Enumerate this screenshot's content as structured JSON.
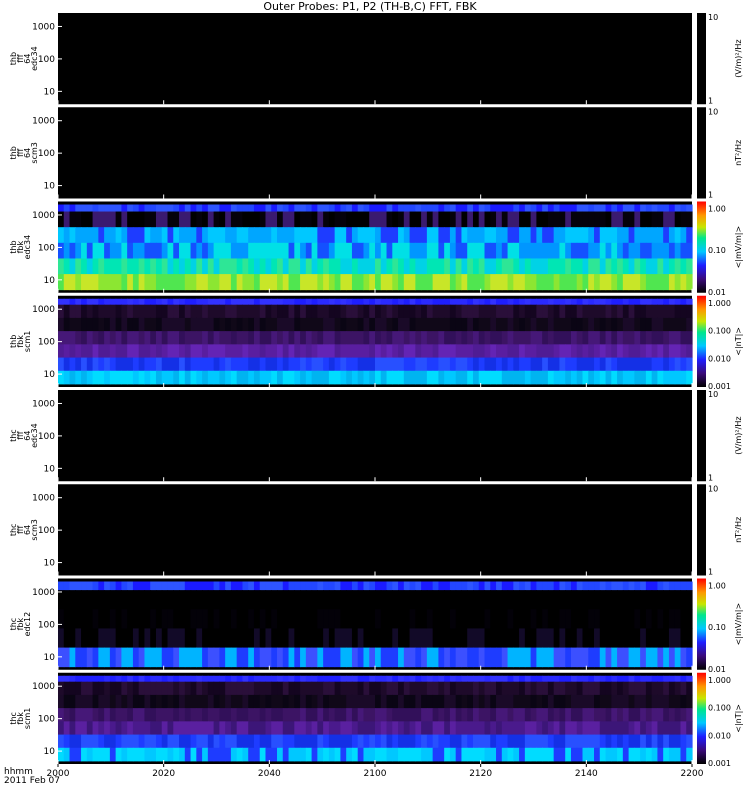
{
  "title": "Outer Probes: P1, P2 (TH-B,C) FFT, FBK",
  "footer": {
    "unit": "hhmm",
    "date": "2011 Feb 07"
  },
  "colors": {
    "background": "#ffffff",
    "panel_empty": "#000000"
  },
  "chart_data": {
    "type": "heatmap",
    "x_ticks": [
      "2000",
      "2020",
      "2040",
      "2100",
      "2120",
      "2140",
      "2200"
    ],
    "x_range": [
      "2000",
      "2200"
    ],
    "panels": [
      {
        "id": "thb_fff64_edc34",
        "label_lines": [
          "thb",
          "fff",
          "64",
          "edc34"
        ],
        "y_ticks": [
          "10",
          "100",
          "1000"
        ],
        "y_scale": "log",
        "colorbar": {
          "type": "gray",
          "ticks": [
            "10",
            "1"
          ],
          "unit": "(V/m)²/Hz"
        },
        "content": "empty"
      },
      {
        "id": "thb_fff64_scm3",
        "label_lines": [
          "thb",
          "fff",
          "64",
          "scm3"
        ],
        "y_ticks": [
          "10",
          "100",
          "1000"
        ],
        "y_scale": "log",
        "colorbar": {
          "type": "gray",
          "ticks": [
            "10",
            "1"
          ],
          "unit": "nT²/Hz"
        },
        "content": "empty"
      },
      {
        "id": "thb_fbk_edc34",
        "label_lines": [
          "thb",
          "fbk",
          "edc34"
        ],
        "y_ticks": [
          "10",
          "100",
          "1000"
        ],
        "y_scale": "log",
        "colorbar": {
          "type": "rainbow",
          "ticks": [
            "1.00",
            "0.10",
            "0.01"
          ],
          "unit": "<|mV/m|>"
        },
        "content": "data",
        "bands": [
          {
            "name": "top",
            "colors": [
              "#2347ff",
              "#1a1aff",
              "#2e55ff"
            ]
          },
          {
            "name": "upper",
            "colors": [
              "#000000",
              "#05020a",
              "#3a1a70"
            ]
          },
          {
            "name": "mid",
            "colors": [
              "#00c8ff",
              "#1e3cff",
              "#00a6ff"
            ]
          },
          {
            "name": "mid2",
            "colors": [
              "#00e0e6",
              "#0096ff",
              "#1450ff"
            ]
          },
          {
            "name": "low",
            "colors": [
              "#00e6b4",
              "#00d2e6",
              "#2ee696"
            ]
          },
          {
            "name": "bottom",
            "colors": [
              "#8ce632",
              "#50e650",
              "#c8e628"
            ]
          }
        ]
      },
      {
        "id": "thb_fbk_scm1",
        "label_lines": [
          "thb",
          "fbk",
          "scm1"
        ],
        "y_ticks": [
          "10",
          "100",
          "1000"
        ],
        "y_scale": "log",
        "colorbar": {
          "type": "rainbow",
          "ticks": [
            "1.000",
            "0.100",
            "0.010",
            "0.001"
          ],
          "unit": "<|nT|>"
        },
        "content": "data",
        "bands": [
          {
            "name": "top",
            "colors": [
              "#2a2aff",
              "#1e1eff",
              "#3232ff"
            ]
          },
          {
            "name": "upper",
            "colors": [
              "#1e0a2a",
              "#140520",
              "#2a0f3a"
            ]
          },
          {
            "name": "upper2",
            "colors": [
              "#0a0514",
              "#100818",
              "#1a0a28"
            ]
          },
          {
            "name": "mid",
            "colors": [
              "#3c1464",
              "#461878",
              "#32105a"
            ]
          },
          {
            "name": "mid2",
            "colors": [
              "#5a1ea0",
              "#501c94",
              "#6424b4"
            ]
          },
          {
            "name": "low",
            "colors": [
              "#1e3cff",
              "#2850ff",
              "#1430e6"
            ]
          },
          {
            "name": "bottom",
            "colors": [
              "#00c8ff",
              "#00dcff",
              "#00b4f0"
            ]
          }
        ]
      },
      {
        "id": "thc_fff64_edc34",
        "label_lines": [
          "thc",
          "fff",
          "64",
          "edc34"
        ],
        "y_ticks": [
          "10",
          "100",
          "1000"
        ],
        "y_scale": "log",
        "colorbar": {
          "type": "gray",
          "ticks": [
            "10",
            "1"
          ],
          "unit": "(V/m)²/Hz"
        },
        "content": "empty"
      },
      {
        "id": "thc_fff64_scm3",
        "label_lines": [
          "thc",
          "fff",
          "64",
          "scm3"
        ],
        "y_ticks": [
          "10",
          "100",
          "1000"
        ],
        "y_scale": "log",
        "colorbar": {
          "type": "gray",
          "ticks": [
            "10",
            "1"
          ],
          "unit": "nT²/Hz"
        },
        "content": "empty"
      },
      {
        "id": "thc_fbk_edc12",
        "label_lines": [
          "thc",
          "fbk",
          "edc12"
        ],
        "y_ticks": [
          "10",
          "100",
          "1000"
        ],
        "y_scale": "log",
        "colorbar": {
          "type": "rainbow",
          "ticks": [
            "1.00",
            "0.10",
            "0.01"
          ],
          "unit": "<|mV/m|>"
        },
        "content": "data",
        "bands": [
          {
            "name": "top",
            "colors": [
              "#2347ff",
              "#1a1aff",
              "#2e55ff"
            ]
          },
          {
            "name": "upper",
            "colors": [
              "#000000",
              "#000000",
              "#000000"
            ]
          },
          {
            "name": "mid",
            "colors": [
              "#000000",
              "#030108",
              "#000000"
            ]
          },
          {
            "name": "low",
            "colors": [
              "#000000",
              "#120a28",
              "#000000"
            ]
          },
          {
            "name": "bottom",
            "colors": [
              "#1e3cff",
              "#00b4ff",
              "#3c50ff"
            ]
          }
        ]
      },
      {
        "id": "thc_fbk_scm1",
        "label_lines": [
          "thc",
          "fbk",
          "scm1"
        ],
        "y_ticks": [
          "10",
          "100",
          "1000"
        ],
        "y_scale": "log",
        "colorbar": {
          "type": "rainbow",
          "ticks": [
            "1.000",
            "0.100",
            "0.010",
            "0.001"
          ],
          "unit": "<|nT|>"
        },
        "content": "data",
        "bands": [
          {
            "name": "top",
            "colors": [
              "#2a2aff",
              "#1e1eff",
              "#3232ff"
            ]
          },
          {
            "name": "upper",
            "colors": [
              "#1e0a2a",
              "#140520",
              "#2a0f3a"
            ]
          },
          {
            "name": "upper2",
            "colors": [
              "#0a0514",
              "#100818",
              "#1a0a28"
            ]
          },
          {
            "name": "mid",
            "colors": [
              "#3c1464",
              "#461878",
              "#32105a"
            ]
          },
          {
            "name": "mid2",
            "colors": [
              "#4a1a8c",
              "#3c1678",
              "#5a20a0"
            ]
          },
          {
            "name": "low",
            "colors": [
              "#1e3cff",
              "#2850ff",
              "#1430e6"
            ]
          },
          {
            "name": "bottom",
            "colors": [
              "#00c8ff",
              "#1e3cff",
              "#00dcff"
            ]
          }
        ]
      }
    ]
  }
}
